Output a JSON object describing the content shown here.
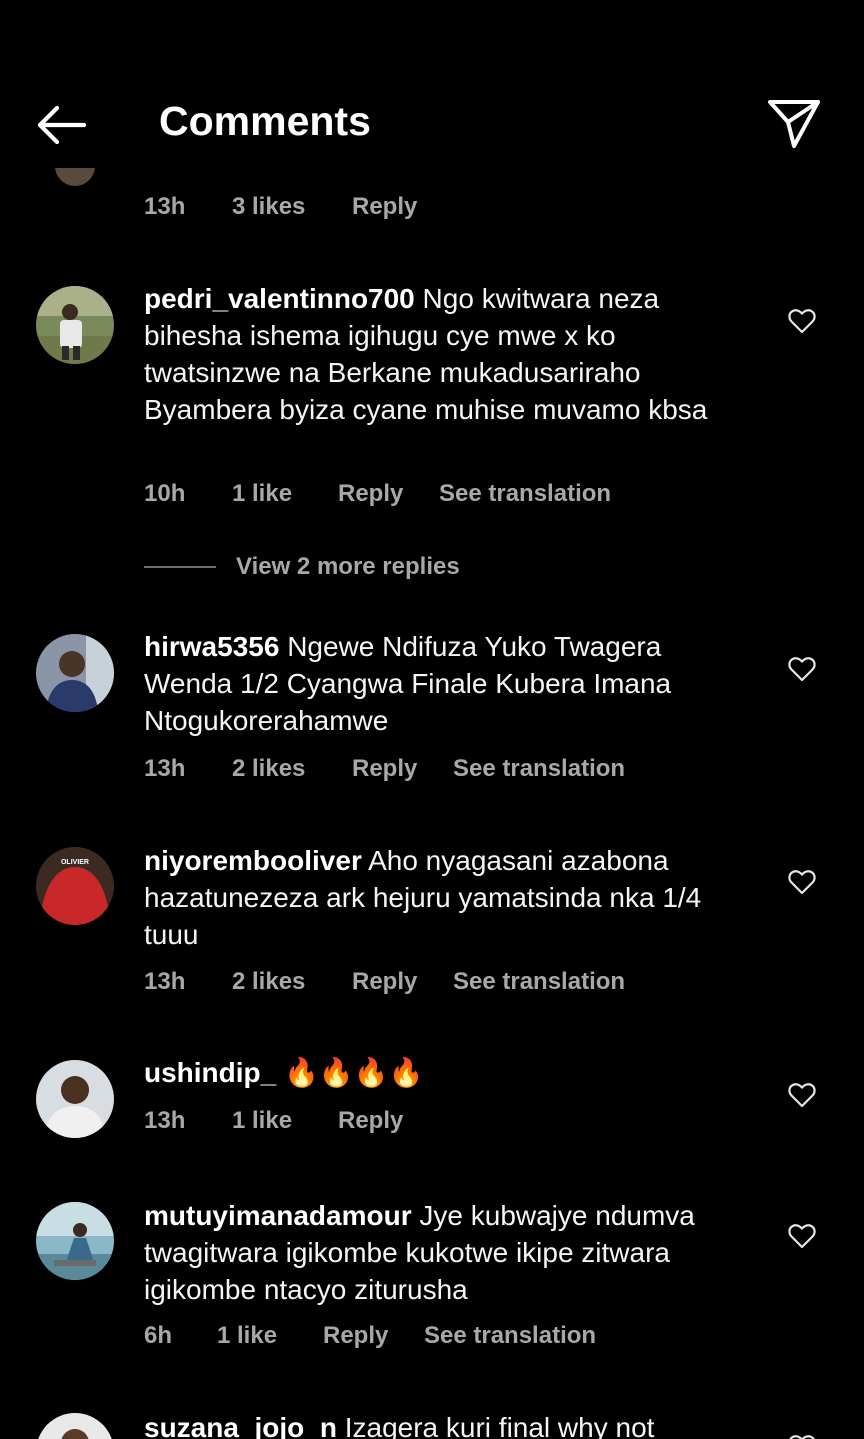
{
  "header": {
    "title": "Comments",
    "back_icon": "arrow-left-icon",
    "share_icon": "paper-plane-icon"
  },
  "top_partial": {
    "time": "13h",
    "likes": "3 likes",
    "reply": "Reply"
  },
  "comments": [
    {
      "username": "pedri_valentinno700",
      "text": "Ngo kwitwara neza bihesha ishema igihugu cye mwe x ko twatsinzwe na Berkane mukadusariraho Byambera byiza cyane muhise muvamo kbsa",
      "time": "10h",
      "likes": "1 like",
      "reply": "Reply",
      "translate": "See translation",
      "view_replies": "View 2 more replies"
    },
    {
      "username": "hirwa5356",
      "text": "Ngewe Ndifuza Yuko Twagera Wenda 1/2 Cyangwa Finale Kubera Imana Ntogukorerahamwe",
      "time": "13h",
      "likes": "2 likes",
      "reply": "Reply",
      "translate": "See translation"
    },
    {
      "username": "niyorembooliver",
      "text": "Aho nyagasani azabona hazatunezeza ark hejuru yamatsinda nka 1/4 tuuu",
      "time": "13h",
      "likes": "2 likes",
      "reply": "Reply",
      "translate": "See translation",
      "avatar_shirt_text": "OLIVIER"
    },
    {
      "username": "ushindip_",
      "text": "🔥🔥🔥🔥",
      "time": "13h",
      "likes": "1 like",
      "reply": "Reply"
    },
    {
      "username": "mutuyimanadamour",
      "text": "Jye kubwajye ndumva twagitwara igikombe kukotwe ikipe zitwara igikombe ntacyo ziturusha",
      "time": "6h",
      "likes": "1 like",
      "reply": "Reply",
      "translate": "See translation"
    },
    {
      "username": "suzana_jojo_n",
      "text": "Izagera kuri final why not"
    }
  ],
  "colors": {
    "background": "#000000",
    "text": "#ffffff",
    "meta": "#a8a8a8"
  }
}
